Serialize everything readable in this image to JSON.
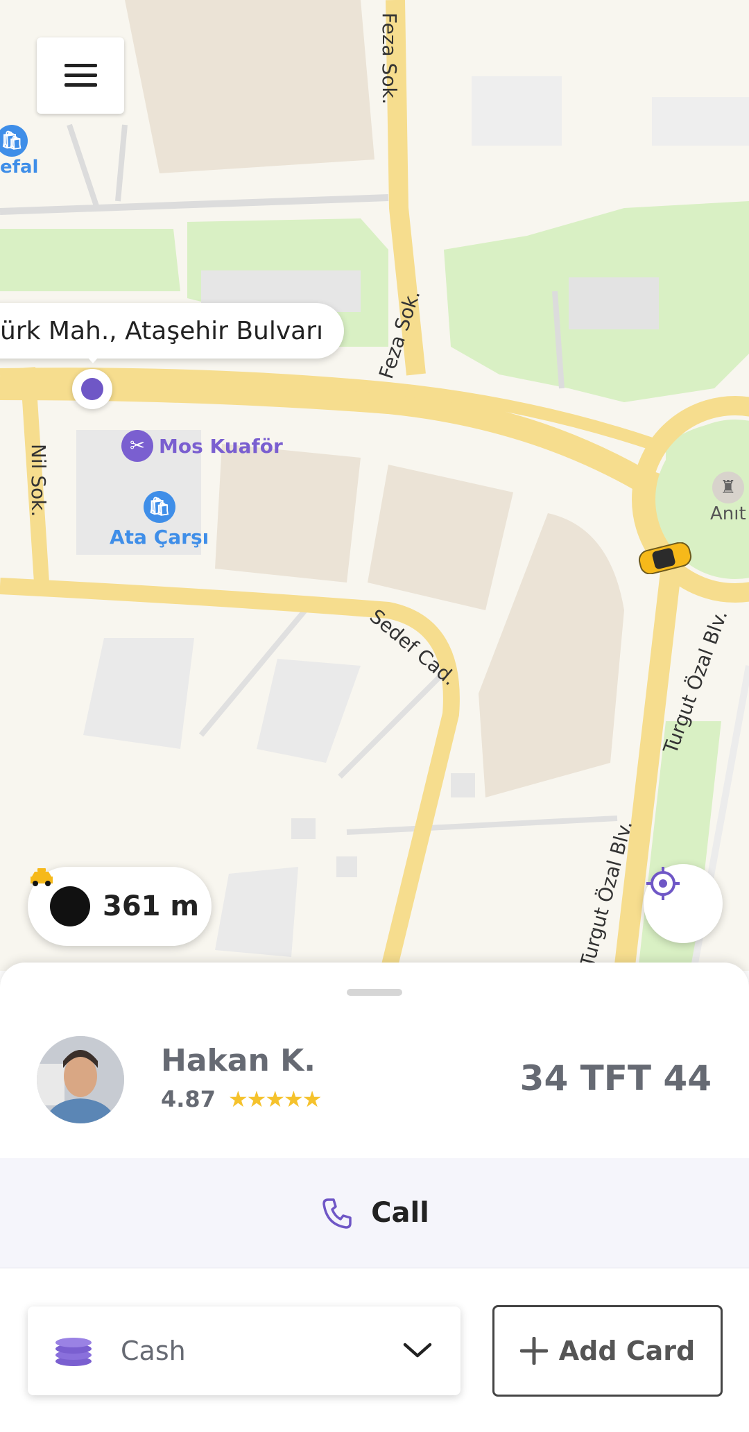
{
  "map": {
    "address_label": "ürk Mah., Ataşehir Bulvarı",
    "street_labels": [
      "Feza Sok.",
      "Feza Sok.",
      "Nil Sok.",
      "Sedef Cad.",
      "Turgut Özal Blv.",
      "Turgut Özal Blv."
    ],
    "pois": {
      "left_partial": "efal",
      "kuafor": "Mos Kuaför",
      "carsi": "Ata Çarşı",
      "monument": "Anıt"
    },
    "distance": "361 m",
    "colors": {
      "road": "#f6dd8e",
      "green": "#d9f0c4",
      "building": "#ebe3d6",
      "accent": "#6f57c6"
    }
  },
  "driver": {
    "name": "Hakan K.",
    "rating": "4.87",
    "stars": "★★★★★",
    "plate": "34 TFT 44"
  },
  "actions": {
    "call_label": "Call"
  },
  "payment": {
    "method": "Cash",
    "add_card_label": "Add Card"
  },
  "icons": [
    "menu-icon",
    "taxi-icon",
    "locate-icon",
    "phone-icon",
    "coins-icon",
    "chevron-down-icon",
    "plus-icon",
    "shopping-bag-icon",
    "scissors-icon",
    "monument-icon",
    "car-icon"
  ]
}
